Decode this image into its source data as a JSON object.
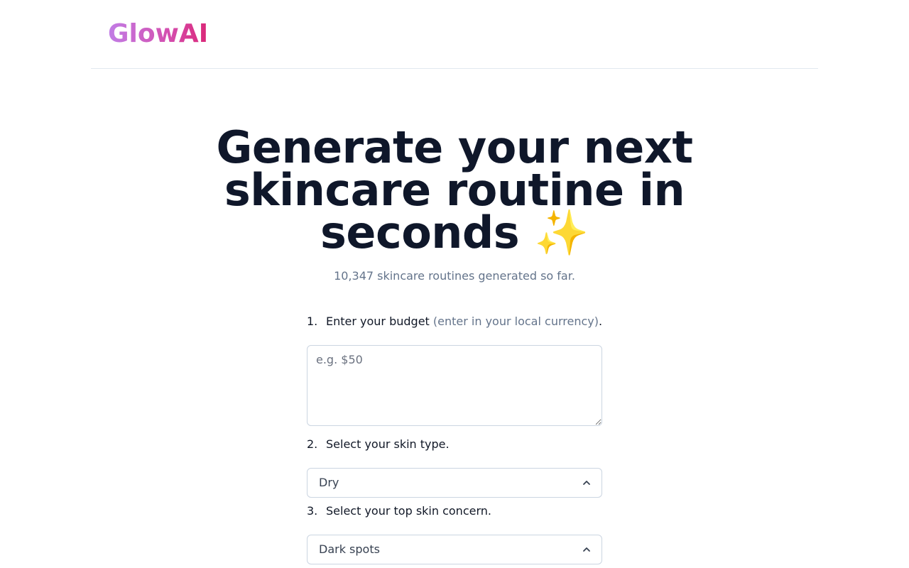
{
  "header": {
    "logo_part1": "Glow",
    "logo_part2": "AI"
  },
  "hero": {
    "title": "Generate your next skincare routine in seconds ✨",
    "counter": "10,347 skincare routines generated so far."
  },
  "form": {
    "step1": {
      "number": "1.",
      "label": "Enter your budget ",
      "hint": "(enter in your local currency)",
      "suffix": ".",
      "placeholder": "e.g. $50",
      "value": ""
    },
    "step2": {
      "number": "2.",
      "label": "Select your skin type.",
      "selected": "Dry"
    },
    "step3": {
      "number": "3.",
      "label": "Select your top skin concern.",
      "selected": "Dark spots"
    }
  },
  "icons": {
    "select_chevron": "chevron-up-icon"
  },
  "colors": {
    "logo_gradient_start": "#c17de6",
    "logo_gradient_end": "#db2777",
    "heading": "#0f172a",
    "muted": "#64748b"
  }
}
